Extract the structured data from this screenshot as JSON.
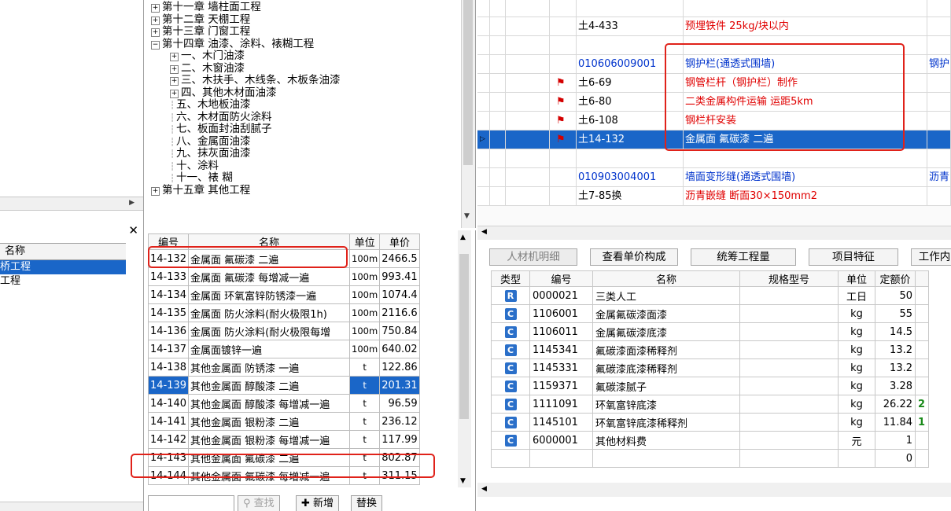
{
  "left_panel": {
    "list_header": "名称",
    "items": [
      {
        "label": "桥工程"
      },
      {
        "label": "工程"
      }
    ]
  },
  "tree": {
    "items": [
      {
        "toggle": "+",
        "label": "第十一章 墙柱面工程"
      },
      {
        "toggle": "+",
        "label": "第十二章 天棚工程"
      },
      {
        "toggle": "+",
        "label": "第十三章 门窗工程"
      },
      {
        "toggle": "-",
        "label": "第十四章 油漆、涂料、裱糊工程"
      },
      {
        "toggle": "+",
        "label": "一、木门油漆"
      },
      {
        "toggle": "+",
        "label": "二、木窗油漆"
      },
      {
        "toggle": "+",
        "label": "三、木扶手、木线条、木板条油漆"
      },
      {
        "toggle": "+",
        "label": "四、其他木材面油漆"
      },
      {
        "toggle": "",
        "label": "五、木地板油漆"
      },
      {
        "toggle": "",
        "label": "六、木材面防火涂料"
      },
      {
        "toggle": "",
        "label": "七、板面封油刮腻子"
      },
      {
        "toggle": "",
        "label": "八、金属面油漆"
      },
      {
        "toggle": "",
        "label": "九、抹灰面油漆"
      },
      {
        "toggle": "",
        "label": "十、涂料"
      },
      {
        "toggle": "",
        "label": "十一、裱  糊"
      },
      {
        "toggle": "+",
        "label": "第十五章 其他工程"
      }
    ]
  },
  "quota_table": {
    "headers": [
      "编号",
      "名称",
      "单位",
      "单价"
    ],
    "rows": [
      {
        "code": "14-132",
        "name": "金属面 氟碳漆 二遍",
        "unit": "100m",
        "price": "2466.5"
      },
      {
        "code": "14-133",
        "name": "金属面 氟碳漆 每增减一遍",
        "unit": "100m",
        "price": "993.41"
      },
      {
        "code": "14-134",
        "name": "金属面 环氧富锌防锈漆一遍",
        "unit": "100m",
        "price": "1074.4"
      },
      {
        "code": "14-135",
        "name": "金属面 防火涂料(耐火极限1h)",
        "unit": "100m",
        "price": "2116.6"
      },
      {
        "code": "14-136",
        "name": "金属面 防火涂料(耐火极限每增",
        "unit": "100m",
        "price": "750.84"
      },
      {
        "code": "14-137",
        "name": "金属面镀锌一遍",
        "unit": "100m",
        "price": "640.02"
      },
      {
        "code": "14-138",
        "name": "其他金属面 防锈漆 一遍",
        "unit": "t",
        "price": "122.86"
      },
      {
        "code": "14-139",
        "name": "其他金属面 醇酸漆 二遍",
        "unit": "t",
        "price": "201.31"
      },
      {
        "code": "14-140",
        "name": "其他金属面 醇酸漆 每增减一遍",
        "unit": "t",
        "price": "96.59"
      },
      {
        "code": "14-141",
        "name": "其他金属面 银粉漆 二遍",
        "unit": "t",
        "price": "236.12"
      },
      {
        "code": "14-142",
        "name": "其他金属面 银粉漆 每增减一遍",
        "unit": "t",
        "price": "117.99"
      },
      {
        "code": "14-143",
        "name": "其他金属面 氟碳漆 二遍",
        "unit": "t",
        "price": "802.87"
      },
      {
        "code": "14-144",
        "name": "其他金属面 氟碳漆 每增减一遍",
        "unit": "t",
        "price": "311.15"
      }
    ],
    "selected_index": 7,
    "buttons": {
      "search": "查找",
      "add": "新增",
      "replace": "替换"
    }
  },
  "bill_grid": {
    "rows": [
      {
        "flag": false,
        "code": "",
        "code_color": "black",
        "name": "",
        "extra": ""
      },
      {
        "flag": false,
        "code": "土4-433",
        "code_color": "black",
        "name": "预埋铁件 25kg/块以内",
        "extra": ""
      },
      {
        "flag": false,
        "code": "",
        "code_color": "black",
        "name": "",
        "extra": ""
      },
      {
        "flag": false,
        "code": "010606009001",
        "code_color": "blue",
        "name": "钢护栏(通透式围墙)",
        "extra": "钢护"
      },
      {
        "flag": true,
        "code": "土6-69",
        "code_color": "black",
        "name": "钢管栏杆（钢护栏）制作",
        "extra": ""
      },
      {
        "flag": true,
        "code": "土6-80",
        "code_color": "black",
        "name": "二类金属构件运输 运距5km",
        "extra": ""
      },
      {
        "flag": true,
        "code": "土6-108",
        "code_color": "black",
        "name": "钢栏杆安装",
        "extra": ""
      },
      {
        "flag": true,
        "code": "土14-132",
        "code_color": "black",
        "name": "金属面 氟碳漆 二遍",
        "extra": ""
      },
      {
        "flag": false,
        "code": "",
        "code_color": "black",
        "name": "",
        "extra": ""
      },
      {
        "flag": false,
        "code": "010903004001",
        "code_color": "blue",
        "name": "墙面变形缝(通透式围墙)",
        "extra": "沥青"
      },
      {
        "flag": false,
        "code": "土7-85换",
        "code_color": "black",
        "name": "沥青嵌缝  断面30×150mm2",
        "extra": ""
      }
    ],
    "selected_index": 7
  },
  "detail": {
    "tabs": [
      "人材机明细",
      "查看单价构成",
      "统筹工程量",
      "项目特征",
      "工作内"
    ],
    "headers": [
      "类型",
      "编号",
      "名称",
      "规格型号",
      "单位",
      "定额价"
    ],
    "rows": [
      {
        "type": "R",
        "code": "0000021",
        "name": "三类人工",
        "spec": "",
        "unit": "工日",
        "price": "50",
        "extra": ""
      },
      {
        "type": "C",
        "code": "1106001",
        "name": "金属氟碳漆面漆",
        "spec": "",
        "unit": "kg",
        "price": "55",
        "extra": ""
      },
      {
        "type": "C",
        "code": "1106011",
        "name": "金属氟碳漆底漆",
        "spec": "",
        "unit": "kg",
        "price": "14.5",
        "extra": ""
      },
      {
        "type": "C",
        "code": "1145341",
        "name": "氟碳漆面漆稀释剂",
        "spec": "",
        "unit": "kg",
        "price": "13.2",
        "extra": ""
      },
      {
        "type": "C",
        "code": "1145331",
        "name": "氟碳漆底漆稀释剂",
        "spec": "",
        "unit": "kg",
        "price": "13.2",
        "extra": ""
      },
      {
        "type": "C",
        "code": "1159371",
        "name": "氟碳漆腻子",
        "spec": "",
        "unit": "kg",
        "price": "3.28",
        "extra": ""
      },
      {
        "type": "C",
        "code": "1111091",
        "name": "环氧富锌底漆",
        "spec": "",
        "unit": "kg",
        "price": "26.22",
        "extra": "2"
      },
      {
        "type": "C",
        "code": "1145101",
        "name": "环氧富锌底漆稀释剂",
        "spec": "",
        "unit": "kg",
        "price": "11.84",
        "extra": "1"
      },
      {
        "type": "C",
        "code": "6000001",
        "name": "其他材料费",
        "spec": "",
        "unit": "元",
        "price": "1",
        "extra": ""
      },
      {
        "type": "",
        "code": "",
        "name": "",
        "spec": "",
        "unit": "",
        "price": "0",
        "extra": ""
      }
    ]
  },
  "colors": {
    "selection": "#1a66c8",
    "highlight_box": "#e0221a",
    "bill_code_blue": "#0033cc",
    "bill_name_red": "#e00000",
    "type_badge": "#2a6fc9"
  }
}
